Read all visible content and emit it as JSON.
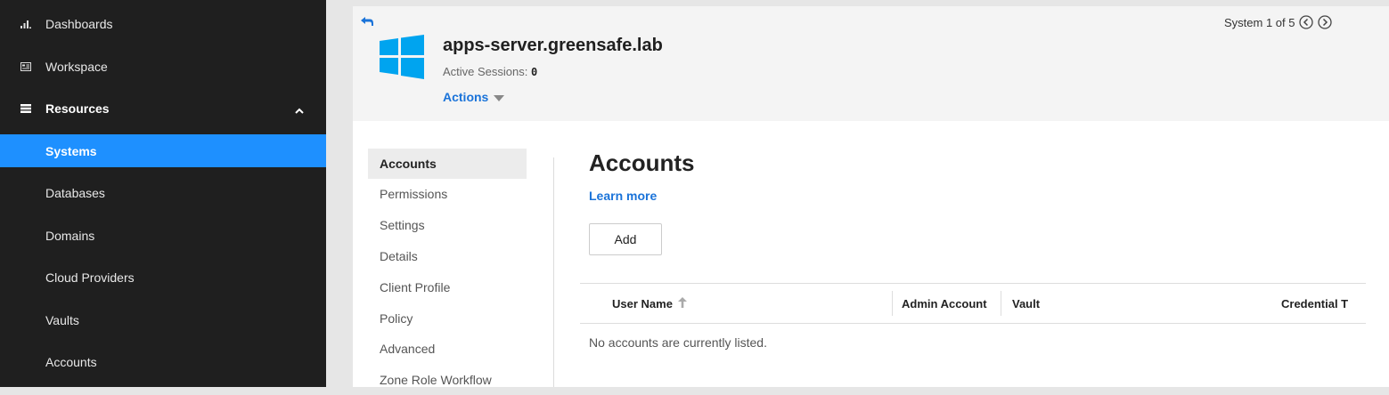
{
  "sidebar": {
    "items": [
      {
        "label": "Dashboards",
        "icon": "bar-chart-icon"
      },
      {
        "label": "Workspace",
        "icon": "workspace-card-icon"
      },
      {
        "label": "Resources",
        "icon": "list-icon",
        "expanded": true
      },
      {
        "label": "Systems",
        "active": true
      },
      {
        "label": "Databases"
      },
      {
        "label": "Domains"
      },
      {
        "label": "Cloud Providers"
      },
      {
        "label": "Vaults"
      },
      {
        "label": "Accounts"
      }
    ]
  },
  "header": {
    "system_name": "apps-server.greensafe.lab",
    "sessions_label": "Active Sessions:",
    "sessions_count": "0",
    "actions_label": "Actions",
    "pager_text": "System 1 of 5"
  },
  "tabs": [
    {
      "label": "Accounts",
      "active": true
    },
    {
      "label": "Permissions"
    },
    {
      "label": "Settings"
    },
    {
      "label": "Details"
    },
    {
      "label": "Client Profile"
    },
    {
      "label": "Policy"
    },
    {
      "label": "Advanced"
    },
    {
      "label": "Zone Role Workflow"
    }
  ],
  "content": {
    "title": "Accounts",
    "learn_more": "Learn more",
    "add_label": "Add",
    "table": {
      "columns": [
        "User Name",
        "Admin Account",
        "Vault",
        "Credential T"
      ],
      "empty_message": "No accounts are currently listed."
    }
  },
  "colors": {
    "accent": "#1e90ff",
    "link": "#1a73d9",
    "sidebar_bg": "#1f1f1f",
    "windows_blue": "#00a4ef"
  }
}
